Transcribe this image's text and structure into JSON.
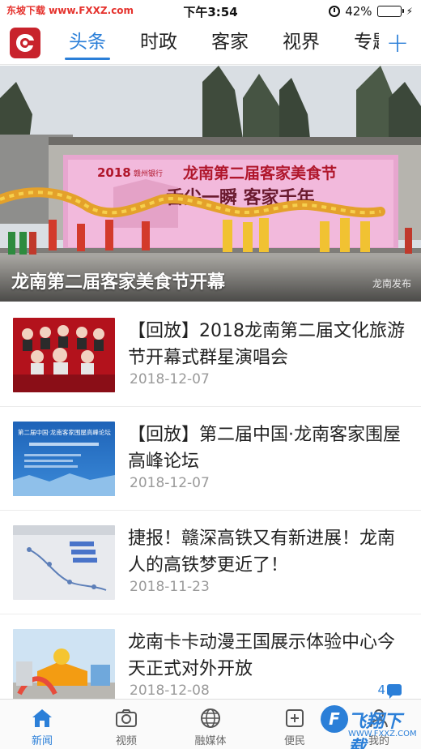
{
  "status_bar": {
    "left_text": "东坡下载 www.FXXZ.com",
    "time": "下午3:54",
    "battery": "42%",
    "battery_level": 0.42
  },
  "nav": {
    "tabs": [
      {
        "label": "头条",
        "active": true
      },
      {
        "label": "时政",
        "active": false
      },
      {
        "label": "客家",
        "active": false
      },
      {
        "label": "视界",
        "active": false
      },
      {
        "label": "专题",
        "active": false
      }
    ],
    "add_label": "+"
  },
  "hero": {
    "title": "龙南第二届客家美食节开幕",
    "watermark": "龙南发布",
    "banner_year": "2018",
    "banner_bank": "赣州银行",
    "banner_title": "龙南第二届客家美食节",
    "banner_slogan": "舌尖一瞬 客家千年"
  },
  "news": [
    {
      "title": "【回放】2018龙南第二届文化旅游节开幕式群星演唱会",
      "date": "2018-12-07",
      "comments": ""
    },
    {
      "title": "【回放】第二届中国·龙南客家围屋高峰论坛",
      "date": "2018-12-07",
      "comments": "",
      "thumb_title": "第二届中国·龙南客家围屋高峰论坛"
    },
    {
      "title": "捷报！赣深高铁又有新进展！龙南人的高铁梦更近了！",
      "date": "2018-11-23",
      "comments": ""
    },
    {
      "title": "龙南卡卡动漫王国展示体验中心今天正式对外开放",
      "date": "2018-12-08",
      "comments": "4"
    }
  ],
  "tabbar": [
    {
      "label": "新闻",
      "icon": "home-icon",
      "active": true
    },
    {
      "label": "视频",
      "icon": "camera-icon",
      "active": false
    },
    {
      "label": "融媒体",
      "icon": "globe-icon",
      "active": false
    },
    {
      "label": "便民",
      "icon": "service-icon",
      "active": false
    },
    {
      "label": "我的",
      "icon": "user-icon",
      "active": false
    }
  ],
  "site_watermark": {
    "text": "飞翔下载",
    "url": "WWW.FXXZ.COM"
  },
  "colors": {
    "accent": "#2b7fd8",
    "logo_red": "#c8232c",
    "date_gray": "#9a9a9a"
  }
}
